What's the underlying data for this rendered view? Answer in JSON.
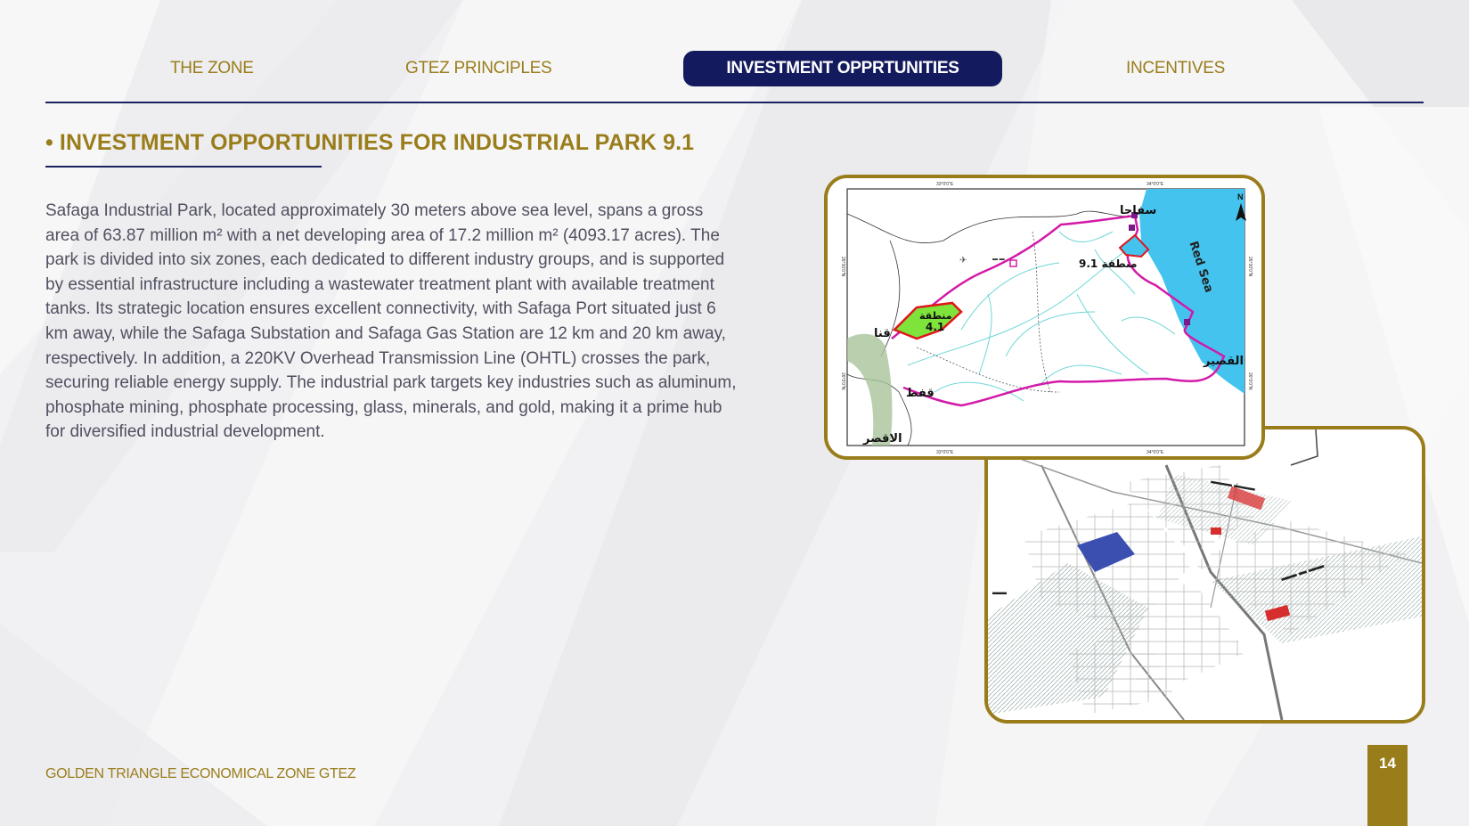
{
  "nav": {
    "items": [
      {
        "label": "THE ZONE"
      },
      {
        "label": "GTEZ PRINCIPLES"
      },
      {
        "label": "INVESTMENT OPPRTUNITIES"
      },
      {
        "label": "INCENTIVES"
      }
    ],
    "active_index": 2
  },
  "section": {
    "title": "• INVESTMENT OPPORTUNITIES FOR INDUSTRIAL PARK 9.1",
    "body": "Safaga Industrial Park, located approximately 30 meters above sea level, spans a gross area of 63.87 million m² with a net developing area of 17.2 million m² (4093.17 acres). The park is divided into six zones, each dedicated to different industry groups, and is supported by essential infrastructure including a wastewater treatment plant with available treatment tanks. Its strategic location ensures excellent connectivity, with Safaga Port situated just 6 km away, while the Safaga Substation and Safaga Gas Station are 12 km and 20 km away, respectively. In addition, a 220KV Overhead Transmission Line (OHTL) crosses the park, securing reliable energy supply. The industrial park targets key industries such as aluminum, phosphate mining, phosphate processing, glass, minerals, and gold, making it a prime hub for diversified industrial development."
  },
  "map": {
    "labels": {
      "safaga": "سفاجا",
      "red_sea": "Red Sea",
      "zone_91": "9.1 منطقة",
      "zone_41_a": "منطقة",
      "zone_41_b": "4.1",
      "qena": "قنا",
      "quseir": "القصير",
      "qift": "قفط",
      "luxor": "الاقصر",
      "north": "N",
      "lon_33": "33°0'0\"E",
      "lon_34": "34°0'0\"E",
      "lat_26": "26°0'0\"N",
      "lat_265": "26°30'0\"N"
    }
  },
  "footer": {
    "text": "GOLDEN TRIANGLE ECONOMICAL ZONE GTEZ",
    "page_number": "14"
  },
  "colors": {
    "gold": "#9a7d1b",
    "navy": "#131a5e",
    "text": "#505060",
    "sea": "#43c3ee",
    "route": "#d31aa8",
    "zone_fill": "#7ee33a",
    "zone_border": "#e0151b",
    "plot_blue": "#3a4fb0"
  },
  "icons": {
    "north_arrow": "north-arrow-icon"
  }
}
